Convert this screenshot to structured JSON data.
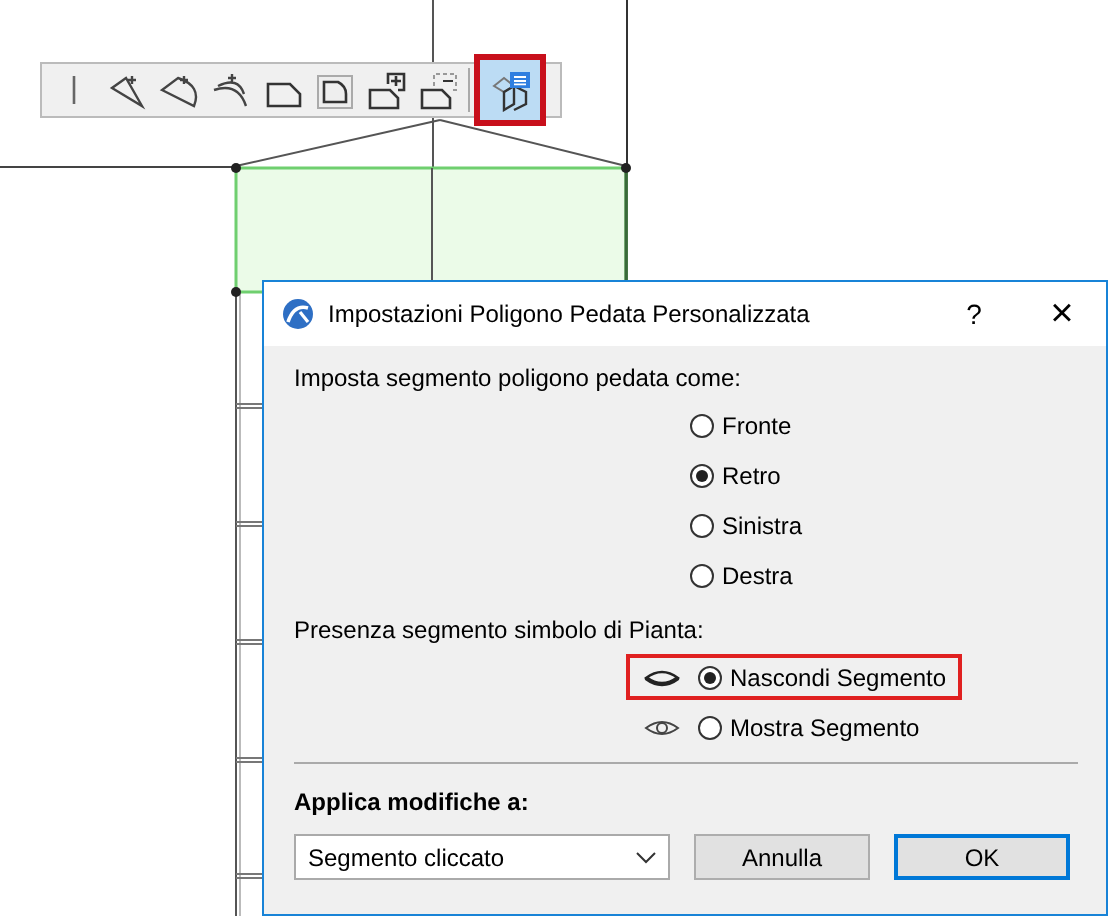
{
  "toolbar": {
    "tools": [
      {
        "kind": "edge",
        "selected": false,
        "highlighted": false
      },
      {
        "kind": "chord",
        "selected": false,
        "highlighted": false
      },
      {
        "kind": "arc",
        "selected": false,
        "highlighted": false
      },
      {
        "kind": "curve",
        "selected": false,
        "highlighted": false
      },
      {
        "kind": "chamfer",
        "selected": false,
        "highlighted": false
      },
      {
        "kind": "rounded",
        "selected": false,
        "highlighted": false
      },
      {
        "kind": "add",
        "selected": false,
        "highlighted": false
      },
      {
        "kind": "subtract",
        "selected": false,
        "highlighted": false
      },
      {
        "kind": "settings",
        "selected": true,
        "highlighted": true
      }
    ]
  },
  "dialog": {
    "title": "Impostazioni Poligono Pedata Personalizzata",
    "help": "?",
    "close": "×",
    "segment_type": {
      "label": "Imposta segmento poligono pedata come:",
      "options": [
        {
          "label": "Fronte",
          "selected": false
        },
        {
          "label": "Retro",
          "selected": true
        },
        {
          "label": "Sinistra",
          "selected": false
        },
        {
          "label": "Destra",
          "selected": false
        }
      ]
    },
    "visibility": {
      "label": "Presenza segmento simbolo di Pianta:",
      "options": [
        {
          "label": "Nascondi Segmento",
          "kind": "hide",
          "selected": true,
          "highlighted": true
        },
        {
          "label": "Mostra Segmento",
          "kind": "show",
          "selected": false,
          "highlighted": false
        }
      ]
    },
    "apply": {
      "label": "Applica modifiche a:",
      "value": "Segmento cliccato"
    },
    "buttons": [
      {
        "label": "Annulla",
        "default": false
      },
      {
        "label": "OK",
        "default": true
      }
    ]
  }
}
